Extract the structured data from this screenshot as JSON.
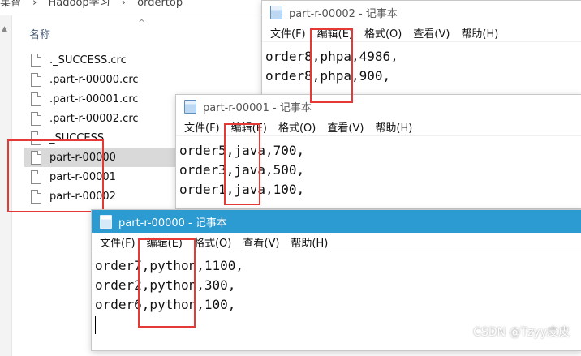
{
  "explorer": {
    "breadcrumb": [
      "集智",
      "Hadoop学习",
      "ordertop"
    ],
    "column_header": "名称",
    "files": [
      {
        "name": "._SUCCESS.crc",
        "selected": false
      },
      {
        "name": ".part-r-00000.crc",
        "selected": false
      },
      {
        "name": ".part-r-00001.crc",
        "selected": false
      },
      {
        "name": ".part-r-00002.crc",
        "selected": false
      },
      {
        "name": "_SUCCESS",
        "selected": false
      },
      {
        "name": "part-r-00000",
        "selected": true
      },
      {
        "name": "part-r-00001",
        "selected": false
      },
      {
        "name": "part-r-00002",
        "selected": false
      }
    ]
  },
  "notepad_menu": [
    "文件(F)",
    "编辑(E)",
    "格式(O)",
    "查看(V)",
    "帮助(H)"
  ],
  "window_00002": {
    "title": "part-r-00002 - 记事本",
    "lines": [
      "order8,phpa,4986,",
      "order8,phpa,900,"
    ]
  },
  "window_00001": {
    "title": "part-r-00001 - 记事本",
    "lines": [
      "order5,java,700,",
      "order3,java,500,",
      "order1,java,100,"
    ]
  },
  "window_00000": {
    "title": "part-r-00000 - 记事本",
    "lines": [
      "order7,python,1100,",
      "order2,python,300,",
      "order6,python,100,"
    ]
  },
  "watermark": "CSDN @Tzyy皮皮",
  "colors": {
    "highlight": "#e53935",
    "active_title": "#2b9bd1"
  }
}
